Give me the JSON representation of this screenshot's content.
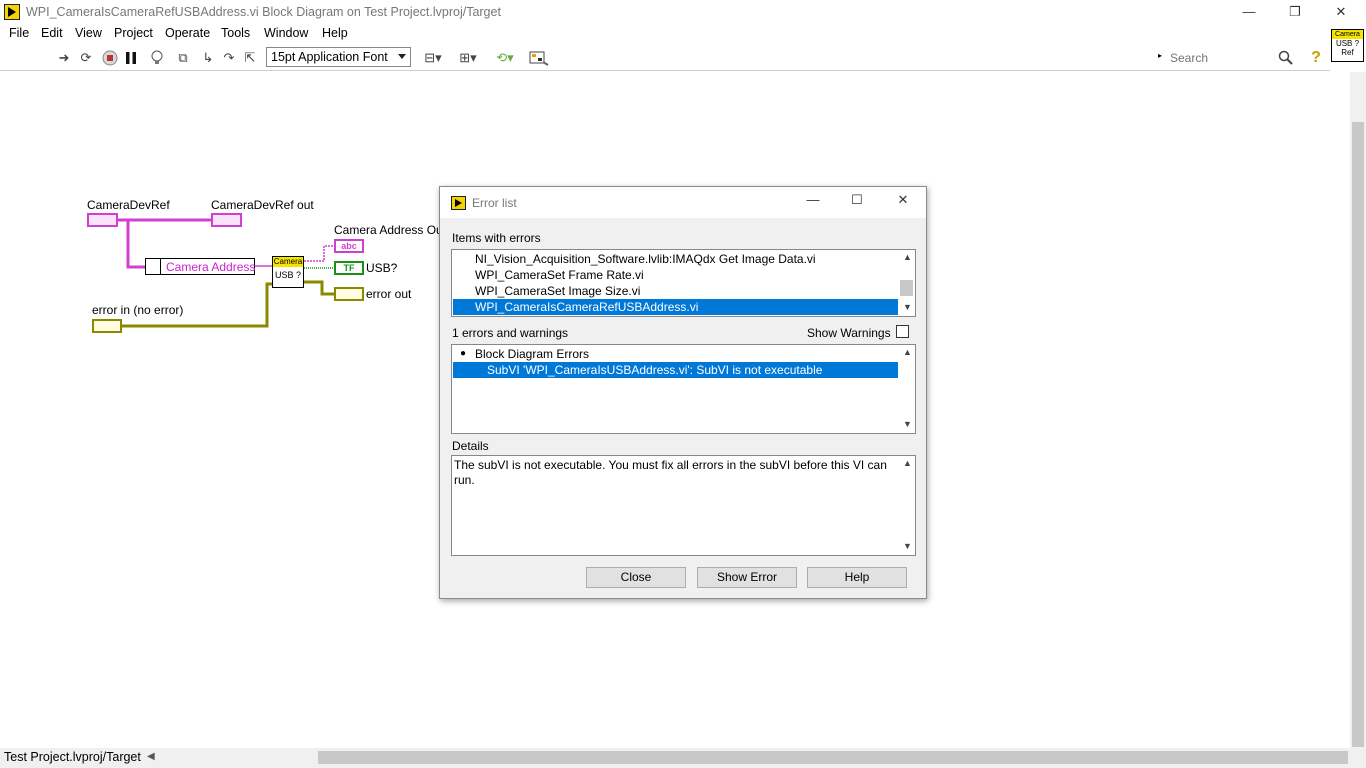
{
  "window": {
    "title": "WPI_CameraIsCameraRefUSBAddress.vi Block Diagram on Test Project.lvproj/Target",
    "minimize": "—",
    "restore": "❐",
    "close": "✕"
  },
  "menu": [
    "File",
    "Edit",
    "View",
    "Project",
    "Operate",
    "Tools",
    "Window",
    "Help"
  ],
  "toolbar": {
    "font": "15pt Application Font",
    "search_placeholder": "Search",
    "vi_icon": {
      "top": "Camera",
      "mid": "USB ?",
      "bot": "Ref"
    }
  },
  "diagram": {
    "camera_dev_ref": "CameraDevRef",
    "camera_dev_ref_out": "CameraDevRef out",
    "camera_address_out": "Camera Address Out",
    "usb_q": "USB?",
    "error_out": "error out",
    "error_in": "error in (no error)",
    "camera_address_const": "Camera Address",
    "subvi_band": "Camera",
    "subvi_text": "USB ?",
    "abc": "abc",
    "tf": "TF"
  },
  "dialog": {
    "title": "Error list",
    "items_label": "Items with errors",
    "items": [
      "NI_Vision_Acquisition_Software.lvlib:IMAQdx Get Image Data.vi",
      "WPI_CameraSet Frame Rate.vi",
      "WPI_CameraSet Image Size.vi",
      "WPI_CameraIsCameraRefUSBAddress.vi"
    ],
    "errors_label": "1 errors and warnings",
    "show_warnings": "Show Warnings",
    "error_group": "Block Diagram Errors",
    "error_item": "SubVI 'WPI_CameraIsUSBAddress.vi': SubVI is not executable",
    "details_label": "Details",
    "details_text": "The subVI is not executable. You must fix all errors in the subVI before this VI can run.",
    "close_btn": "Close",
    "show_error_btn": "Show Error",
    "help_btn": "Help"
  },
  "status": {
    "context": "Test Project.lvproj/Target"
  }
}
